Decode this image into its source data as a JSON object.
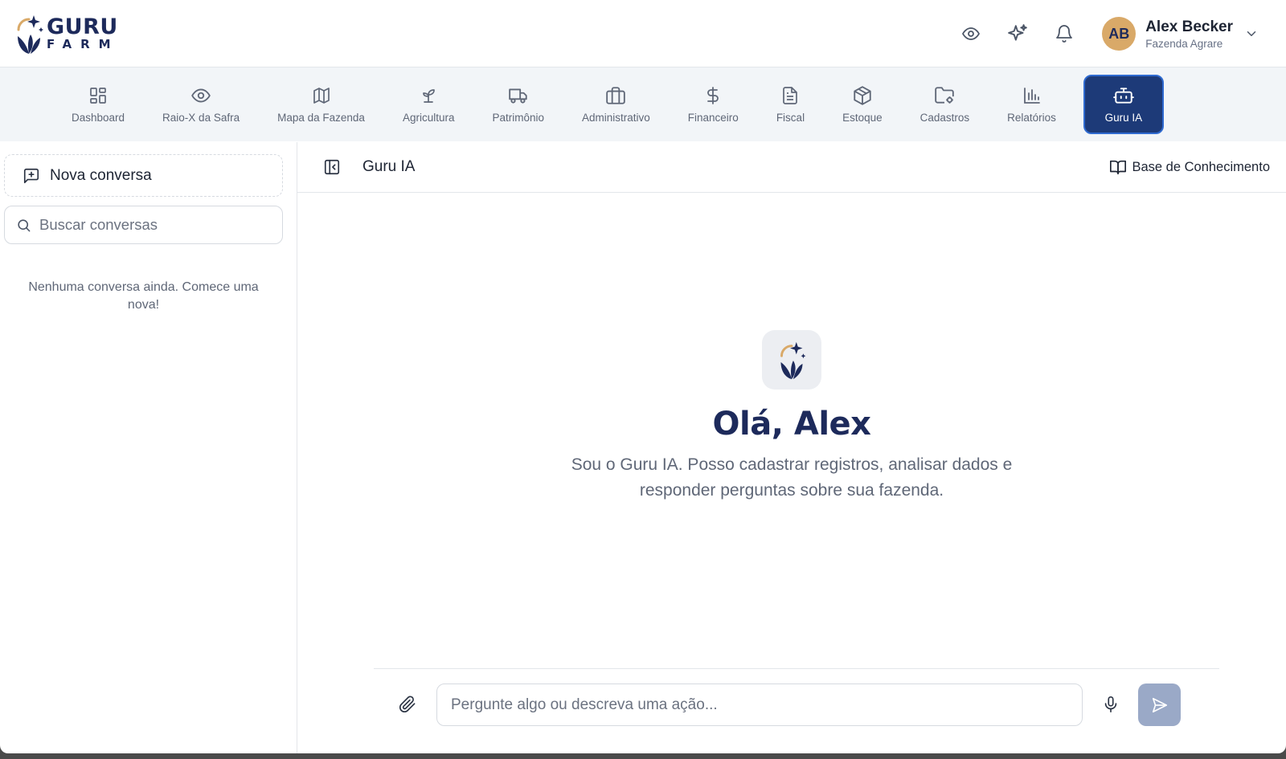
{
  "brand": {
    "line1": "GURU",
    "line2": "FARM"
  },
  "header": {
    "icons": [
      "eye-icon",
      "sparkles-icon",
      "bell-icon"
    ],
    "user": {
      "initials": "AB",
      "name": "Alex Becker",
      "farm": "Fazenda Agrare"
    }
  },
  "nav": {
    "items": [
      {
        "label": "Dashboard",
        "icon": "dashboard-icon"
      },
      {
        "label": "Raio-X da Safra",
        "icon": "eye-icon"
      },
      {
        "label": "Mapa da Fazenda",
        "icon": "map-icon"
      },
      {
        "label": "Agricultura",
        "icon": "sprout-icon"
      },
      {
        "label": "Patrimônio",
        "icon": "truck-icon"
      },
      {
        "label": "Administrativo",
        "icon": "briefcase-icon"
      },
      {
        "label": "Financeiro",
        "icon": "dollar-icon"
      },
      {
        "label": "Fiscal",
        "icon": "document-icon"
      },
      {
        "label": "Estoque",
        "icon": "package-icon"
      },
      {
        "label": "Cadastros",
        "icon": "folder-settings-icon"
      },
      {
        "label": "Relatórios",
        "icon": "bar-chart-icon"
      },
      {
        "label": "Guru IA",
        "icon": "bot-icon",
        "active": true
      }
    ]
  },
  "sidebar": {
    "new_chat_label": "Nova conversa",
    "search_placeholder": "Buscar conversas",
    "empty_text": "Nenhuma conversa ainda. Comece uma nova!"
  },
  "chat": {
    "title": "Guru IA",
    "knowledge_base_label": "Base de Conhecimento",
    "greeting": "Olá, Alex",
    "subtitle": "Sou o Guru IA. Posso cadastrar registros, analisar dados e responder perguntas sobre sua fazenda.",
    "input_placeholder": "Pergunte algo ou descreva uma ação..."
  },
  "colors": {
    "navy": "#1d2a5b",
    "accent": "#1d3a78",
    "gold": "#d9a968",
    "send_disabled": "#9aa9c7"
  }
}
